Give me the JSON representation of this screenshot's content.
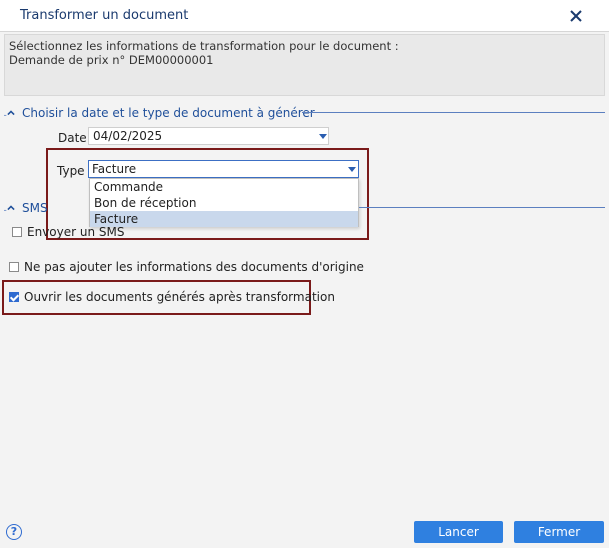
{
  "window": {
    "title": "Transformer un document"
  },
  "info": {
    "line1": "Sélectionnez les informations de transformation pour le document :",
    "line2": "Demande de prix n° DEM00000001"
  },
  "section_date_type": {
    "label": "Choisir la date et le type de document à générer",
    "date_label": "Date",
    "date_value": "04/02/2025",
    "type_label": "Type",
    "type_value": "Facture",
    "type_options": [
      "Commande",
      "Bon de réception",
      "Facture"
    ],
    "selected_option_index": 2
  },
  "section_sms": {
    "label": "SMS",
    "send_sms_label": "Envoyer un SMS",
    "send_sms_checked": false
  },
  "options": {
    "no_origin_info_label": "Ne pas ajouter les informations des documents d'origine",
    "no_origin_info_checked": false,
    "open_generated_label": "Ouvrir les documents générés après transformation",
    "open_generated_checked": true
  },
  "footer": {
    "help_glyph": "?",
    "launch_label": "Lancer",
    "close_label": "Fermer"
  },
  "colors": {
    "accent": "#2f80e0",
    "highlight": "#7a1a1a",
    "section": "#1f4f9a"
  },
  "icons": {
    "close": "close-icon",
    "help": "help-icon",
    "collapse": "chevron-up-icon",
    "dropdown": "chevron-down-icon"
  }
}
